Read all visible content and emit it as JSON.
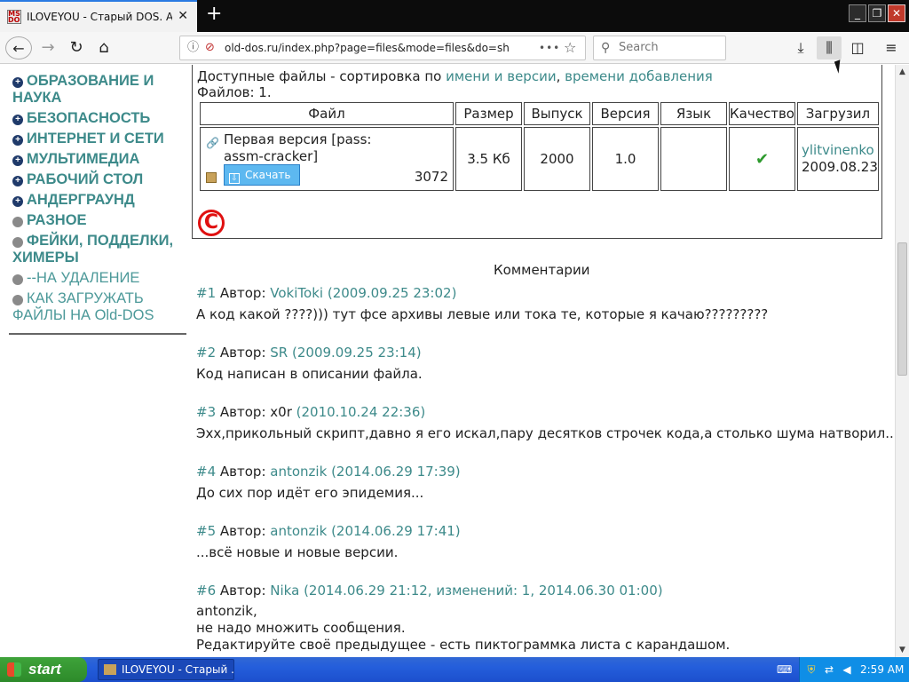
{
  "browser": {
    "tab_title": "ILOVEYOU - Старый DOS. Abandonware",
    "new_tab": "+",
    "url": "old-dos.ru/index.php?page=files&mode=files&do=show",
    "search_placeholder": "Search",
    "more": "•••"
  },
  "sidebar": {
    "items": [
      {
        "label": "ОБРАЗОВАНИЕ И",
        "label2": "НАУКА"
      },
      {
        "label": "БЕЗОПАСНОСТЬ"
      },
      {
        "label": "ИНТЕРНЕТ И СЕТИ"
      },
      {
        "label": "МУЛЬТИМЕДИА"
      },
      {
        "label": "РАБОЧИЙ СТОЛ"
      },
      {
        "label": "АНДЕРГРАУНД"
      },
      {
        "label": "РАЗНОЕ"
      },
      {
        "label": "ФЕЙКИ, ПОДДЕЛКИ,",
        "label2": "ХИМЕРЫ"
      },
      {
        "label": "--НА УДАЛЕНИЕ"
      },
      {
        "label": "КАК ЗАГРУЖАТЬ",
        "label2": "ФАЙЛЫ НА Old-DOS"
      }
    ]
  },
  "files": {
    "sort_prefix": "Доступные файлы - сортировка по ",
    "sort_by_name": "имени и версии",
    "sort_sep": ", ",
    "sort_by_date": "времени добавления",
    "count": "Файлов: 1.",
    "headers": [
      "Файл",
      "Размер",
      "Выпуск",
      "Версия",
      "Язык",
      "Качество",
      "Загрузил"
    ],
    "row": {
      "title": "Первая версия [pass: assm-cracker]",
      "download": "Скачать",
      "downloads": "3072",
      "size": "3.5 Кб",
      "year": "2000",
      "version": "1.0",
      "language": "",
      "uploader": "ylitvinenko",
      "upload_date": "2009.08.23"
    }
  },
  "comments_title": "Комментарии",
  "comments": [
    {
      "num": "#1",
      "by": "Автор:",
      "author": "VokiToki",
      "date": "(2009.09.25 23:02)",
      "text": "А код какой ????))) тут фсе архивы левые или тока те, которые я качаю?????????"
    },
    {
      "num": "#2",
      "by": "Автор:",
      "author": "SR",
      "date": "(2009.09.25 23:14)",
      "text": "Код написан в описании файла."
    },
    {
      "num": "#3",
      "by": "Автор:",
      "author": "x0r",
      "date": "(2010.10.24 22:36)",
      "text": "Эхх,прикольный скрипт,давно я его искал,пару десятков строчек кода,а столько шума натворил..."
    },
    {
      "num": "#4",
      "by": "Автор:",
      "author": "antonzik",
      "date": "(2014.06.29 17:39)",
      "text": "До сих пор идёт его эпидемия..."
    },
    {
      "num": "#5",
      "by": "Автор:",
      "author": "antonzik",
      "date": "(2014.06.29 17:41)",
      "text": "...всё новые и новые версии."
    },
    {
      "num": "#6",
      "by": "Автор:",
      "author": "Nika",
      "date": "(2014.06.29 21:12, изменений: 1, 2014.06.30 01:00)",
      "text": "antonzik,",
      "text2": "не надо множить сообщения.",
      "text3": "Редактируйте своё предыдущее - есть пиктограммка листа с карандашом."
    }
  ],
  "taskbar": {
    "start": "start",
    "task": "ILOVEYOU - Старый ...",
    "clock": "2:59 AM"
  },
  "colors": {
    "link": "#3d8a8a",
    "bullet": "#1f3a6a",
    "check": "#2e9a2e",
    "copyright": "#e01010"
  }
}
